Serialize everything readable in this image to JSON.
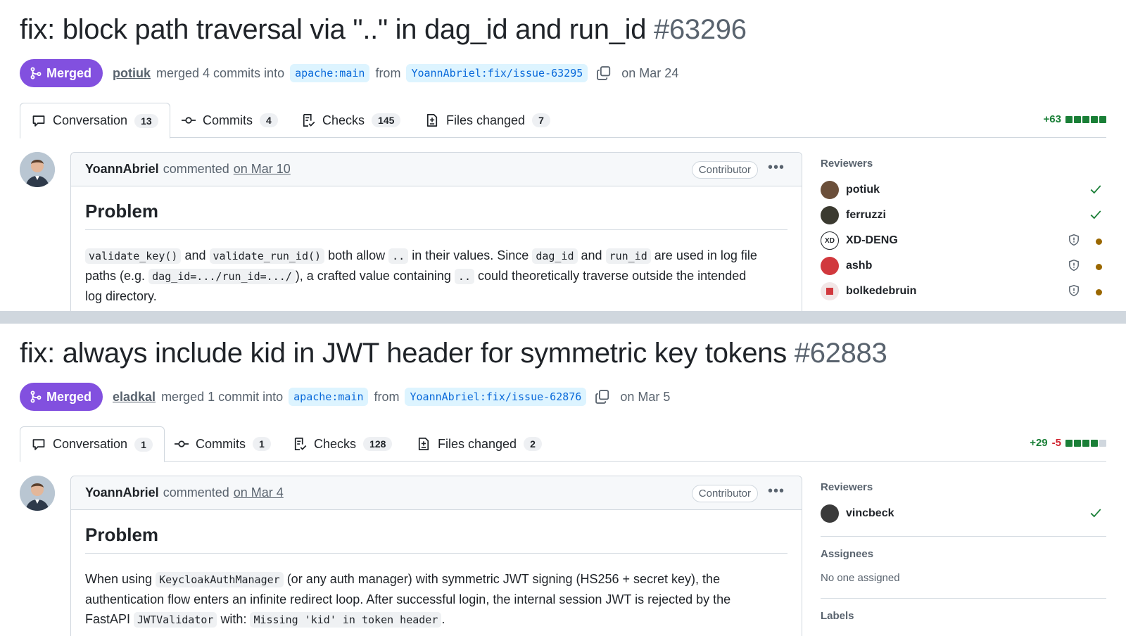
{
  "panels": [
    {
      "title": "fix: block path traversal via \"..\" in dag_id and run_id",
      "number": "#63296",
      "status": "Merged",
      "author": "potiuk",
      "merge_text": "merged 4 commits into",
      "base_branch": "apache:main",
      "from_text": "from",
      "head_branch": "YoannAbriel:fix/issue-63295",
      "date": "on Mar 24",
      "tabs": [
        {
          "label": "Conversation",
          "count": "13",
          "icon": "comment-icon"
        },
        {
          "label": "Commits",
          "count": "4",
          "icon": "commit-icon"
        },
        {
          "label": "Checks",
          "count": "145",
          "icon": "checklist-icon"
        },
        {
          "label": "Files changed",
          "count": "7",
          "icon": "file-diff-icon"
        }
      ],
      "diffstat": {
        "additions": "+63",
        "deletions": "",
        "blocks": [
          "green",
          "green",
          "green",
          "green",
          "green"
        ]
      },
      "comment": {
        "author": "YoannAbriel",
        "action": "commented",
        "date": "on Mar 10",
        "role": "Contributor",
        "heading": "Problem",
        "line1": {
          "c1": "validate_key()",
          "t1": "and",
          "c2": "validate_run_id()",
          "t2": "both allow",
          "c3": "..",
          "t3": "in their values. Since",
          "c4": "dag_id",
          "t4": "and",
          "c5": "run_id",
          "t5": "are used in log file"
        },
        "line2": {
          "t1": "paths (e.g.",
          "c1": "dag_id=.../run_id=.../",
          "t2": "), a crafted value containing",
          "c2": "..",
          "t3": "could theoretically traverse outside the intended"
        },
        "line3": "log directory."
      },
      "sidebar": {
        "reviewers_title": "Reviewers",
        "reviewers": [
          {
            "name": "potiuk",
            "status": "approved",
            "avatar_color": "#6b4f3a"
          },
          {
            "name": "ferruzzi",
            "status": "approved",
            "avatar_color": "#3b3a30"
          },
          {
            "name": "XD-DENG",
            "status": "pending",
            "avatar_color": "#ffffff"
          },
          {
            "name": "ashb",
            "status": "pending",
            "avatar_color": "#d1383d"
          },
          {
            "name": "bolkedebruin",
            "status": "pending",
            "avatar_color": "#f2e6e6"
          }
        ]
      }
    },
    {
      "title": "fix: always include kid in JWT header for symmetric key tokens",
      "number": "#62883",
      "status": "Merged",
      "author": "eladkal",
      "merge_text": "merged 1 commit into",
      "base_branch": "apache:main",
      "from_text": "from",
      "head_branch": "YoannAbriel:fix/issue-62876",
      "date": "on Mar 5",
      "tabs": [
        {
          "label": "Conversation",
          "count": "1",
          "icon": "comment-icon"
        },
        {
          "label": "Commits",
          "count": "1",
          "icon": "commit-icon"
        },
        {
          "label": "Checks",
          "count": "128",
          "icon": "checklist-icon"
        },
        {
          "label": "Files changed",
          "count": "2",
          "icon": "file-diff-icon"
        }
      ],
      "diffstat": {
        "additions": "+29",
        "deletions": "-5",
        "blocks": [
          "green",
          "green",
          "green",
          "green",
          "gray"
        ]
      },
      "comment": {
        "author": "YoannAbriel",
        "action": "commented",
        "date": "on Mar 4",
        "role": "Contributor",
        "heading": "Problem",
        "line1": {
          "t1": "When using",
          "c1": "KeycloakAuthManager",
          "t2": "(or any auth manager) with symmetric JWT signing (HS256 + secret key), the"
        },
        "line2": "authentication flow enters an infinite redirect loop. After successful login, the internal session JWT is rejected by the",
        "line3": {
          "t1": "FastAPI",
          "c1": "JWTValidator",
          "t2": "with:",
          "c2": "Missing 'kid' in token header",
          "t3": "."
        }
      },
      "sidebar": {
        "reviewers_title": "Reviewers",
        "reviewers": [
          {
            "name": "vincbeck",
            "status": "approved",
            "avatar_color": "#3a3a3a"
          }
        ],
        "assignees_title": "Assignees",
        "assignees_text": "No one assigned",
        "labels_title": "Labels"
      }
    }
  ],
  "colors": {
    "merged": "#8250df",
    "link": "#0969da",
    "add": "#1a7f37",
    "del": "#d1242f",
    "pending": "#9a6700"
  }
}
